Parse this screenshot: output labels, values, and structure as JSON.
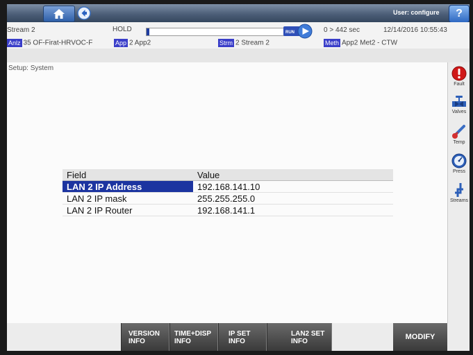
{
  "header": {
    "user_label": "User: configure",
    "help_label": "?"
  },
  "status": {
    "stream": "Stream 2",
    "hold": "HOLD",
    "progress_fraction": 0.02,
    "run_label": "RUN",
    "time_range": "0 > 442 sec",
    "datetime": "12/14/2016 10:55:43"
  },
  "info": {
    "anlz_tag": "Anlz",
    "anlz_value": "35 OF-Firat-HRVOC-F",
    "app_tag": "App",
    "app_value": "2 App2",
    "strm_tag": "Strm",
    "strm_value": "2 Stream 2",
    "meth_tag": "Meth",
    "meth_value": "App2 Met2 - CTW"
  },
  "breadcrumb": "Setup: System",
  "table": {
    "headers": [
      "Field",
      "Value"
    ],
    "rows": [
      {
        "field": "LAN 2 IP Address",
        "value": "192.168.141.10"
      },
      {
        "field": "LAN 2 IP mask",
        "value": "255.255.255.0"
      },
      {
        "field": "LAN 2 IP Router",
        "value": "192.168.141.1"
      }
    ]
  },
  "sidebar": {
    "fault": "Fault",
    "valves": "Valves",
    "temp": "Temp",
    "press": "Press",
    "streams": "Streams"
  },
  "bottom": {
    "version_1": "VERSION",
    "version_2": "INFO",
    "time_1": "TIME+DISP",
    "time_2": "INFO",
    "ipset_1": "IP SET",
    "ipset_2": "INFO",
    "lan2_1": "LAN2 SET",
    "lan2_2": "INFO",
    "modify": "MODIFY"
  },
  "colors": {
    "selection": "#1c34a0",
    "tag": "#3a3ec9",
    "fault": "#d01818",
    "title_bar": "#4d5f78"
  }
}
